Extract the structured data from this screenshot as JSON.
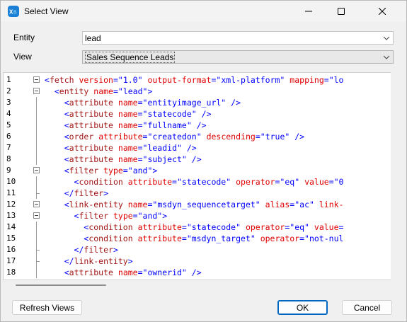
{
  "window": {
    "title": "Select View"
  },
  "entity": {
    "label": "Entity",
    "value": "lead"
  },
  "view": {
    "label": "View",
    "value": "Sales Sequence Leads"
  },
  "editor": {
    "lines": [
      {
        "n": "1",
        "html": "<span class=\"p\">&lt;</span><span class=\"t\">fetch</span> <span class=\"a\">version</span><span class=\"p\">=</span><span class=\"v\">\"1.0\"</span> <span class=\"a\">output-format</span><span class=\"p\">=</span><span class=\"v\">\"xml-platform\"</span> <span class=\"a\">mapping</span><span class=\"p\">=</span><span class=\"v\">\"lo</span>"
      },
      {
        "n": "2",
        "html": "  <span class=\"p\">&lt;</span><span class=\"t\">entity</span> <span class=\"a\">name</span><span class=\"p\">=</span><span class=\"v\">\"lead\"</span><span class=\"p\">&gt;</span>"
      },
      {
        "n": "3",
        "html": "    <span class=\"p\">&lt;</span><span class=\"t\">attribute</span> <span class=\"a\">name</span><span class=\"p\">=</span><span class=\"v\">\"entityimage_url\"</span> <span class=\"p\">/&gt;</span>"
      },
      {
        "n": "4",
        "html": "    <span class=\"p\">&lt;</span><span class=\"t\">attribute</span> <span class=\"a\">name</span><span class=\"p\">=</span><span class=\"v\">\"statecode\"</span> <span class=\"p\">/&gt;</span>"
      },
      {
        "n": "5",
        "html": "    <span class=\"p\">&lt;</span><span class=\"t\">attribute</span> <span class=\"a\">name</span><span class=\"p\">=</span><span class=\"v\">\"fullname\"</span> <span class=\"p\">/&gt;</span>"
      },
      {
        "n": "6",
        "html": "    <span class=\"p\">&lt;</span><span class=\"t\">order</span> <span class=\"a\">attribute</span><span class=\"p\">=</span><span class=\"v\">\"createdon\"</span> <span class=\"a\">descending</span><span class=\"p\">=</span><span class=\"v\">\"true\"</span> <span class=\"p\">/&gt;</span>"
      },
      {
        "n": "7",
        "html": "    <span class=\"p\">&lt;</span><span class=\"t\">attribute</span> <span class=\"a\">name</span><span class=\"p\">=</span><span class=\"v\">\"leadid\"</span> <span class=\"p\">/&gt;</span>"
      },
      {
        "n": "8",
        "html": "    <span class=\"p\">&lt;</span><span class=\"t\">attribute</span> <span class=\"a\">name</span><span class=\"p\">=</span><span class=\"v\">\"subject\"</span> <span class=\"p\">/&gt;</span>"
      },
      {
        "n": "9",
        "html": "    <span class=\"p\">&lt;</span><span class=\"t\">filter</span> <span class=\"a\">type</span><span class=\"p\">=</span><span class=\"v\">\"and\"</span><span class=\"p\">&gt;</span>"
      },
      {
        "n": "10",
        "html": "      <span class=\"p\">&lt;</span><span class=\"t\">condition</span> <span class=\"a\">attribute</span><span class=\"p\">=</span><span class=\"v\">\"statecode\"</span> <span class=\"a\">operator</span><span class=\"p\">=</span><span class=\"v\">\"eq\"</span> <span class=\"a\">value</span><span class=\"p\">=</span><span class=\"v\">\"0</span>"
      },
      {
        "n": "11",
        "html": "    <span class=\"p\">&lt;/</span><span class=\"t\">filter</span><span class=\"p\">&gt;</span>"
      },
      {
        "n": "12",
        "html": "    <span class=\"p\">&lt;</span><span class=\"t\">link-entity</span> <span class=\"a\">name</span><span class=\"p\">=</span><span class=\"v\">\"msdyn_sequencetarget\"</span> <span class=\"a\">alias</span><span class=\"p\">=</span><span class=\"v\">\"ac\"</span> <span class=\"a\">link-</span>"
      },
      {
        "n": "13",
        "html": "      <span class=\"p\">&lt;</span><span class=\"t\">filter</span> <span class=\"a\">type</span><span class=\"p\">=</span><span class=\"v\">\"and\"</span><span class=\"p\">&gt;</span>"
      },
      {
        "n": "14",
        "html": "        <span class=\"p\">&lt;</span><span class=\"t\">condition</span> <span class=\"a\">attribute</span><span class=\"p\">=</span><span class=\"v\">\"statecode\"</span> <span class=\"a\">operator</span><span class=\"p\">=</span><span class=\"v\">\"eq\"</span> <span class=\"a\">value</span><span class=\"p\">=</span>"
      },
      {
        "n": "15",
        "html": "        <span class=\"p\">&lt;</span><span class=\"t\">condition</span> <span class=\"a\">attribute</span><span class=\"p\">=</span><span class=\"v\">\"msdyn_target\"</span> <span class=\"a\">operator</span><span class=\"p\">=</span><span class=\"v\">\"not-nul</span>"
      },
      {
        "n": "16",
        "html": "      <span class=\"p\">&lt;/</span><span class=\"t\">filter</span><span class=\"p\">&gt;</span>"
      },
      {
        "n": "17",
        "html": "    <span class=\"p\">&lt;/</span><span class=\"t\">link-entity</span><span class=\"p\">&gt;</span>"
      },
      {
        "n": "18",
        "html": "    <span class=\"p\">&lt;</span><span class=\"t\">attribute</span> <span class=\"a\">name</span><span class=\"p\">=</span><span class=\"v\">\"ownerid\"</span> <span class=\"p\">/&gt;</span>"
      }
    ]
  },
  "buttons": {
    "refresh": "Refresh Views",
    "ok": "OK",
    "cancel": "Cancel"
  },
  "icons": {
    "app": "xrmtoolbox-app-icon",
    "minimize": "minimize-icon",
    "maximize": "maximize-icon",
    "close": "close-icon"
  }
}
